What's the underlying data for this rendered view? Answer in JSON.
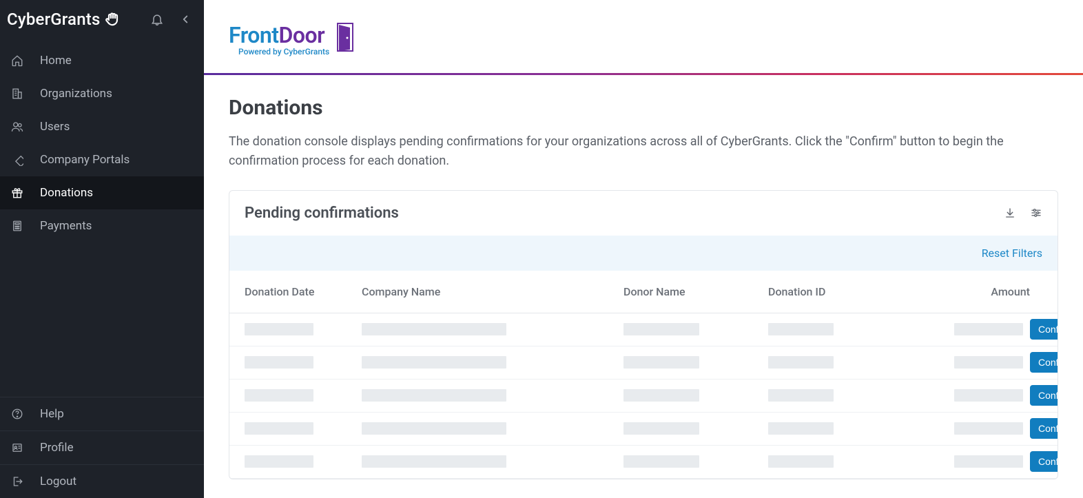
{
  "brand": {
    "name": "CyberGrants"
  },
  "sidebar": {
    "items": [
      {
        "id": "home",
        "label": "Home",
        "icon": "home-icon"
      },
      {
        "id": "orgs",
        "label": "Organizations",
        "icon": "building-icon"
      },
      {
        "id": "users",
        "label": "Users",
        "icon": "users-icon"
      },
      {
        "id": "portals",
        "label": "Company Portals",
        "icon": "diamond-icon"
      },
      {
        "id": "donations",
        "label": "Donations",
        "icon": "gift-icon",
        "active": true
      },
      {
        "id": "payments",
        "label": "Payments",
        "icon": "calc-icon"
      }
    ],
    "bottom": [
      {
        "id": "help",
        "label": "Help",
        "icon": "help-icon"
      },
      {
        "id": "profile",
        "label": "Profile",
        "icon": "id-icon"
      },
      {
        "id": "logout",
        "label": "Logout",
        "icon": "logout-icon"
      }
    ]
  },
  "logo": {
    "front": "Front",
    "door": "Door",
    "subtitle": "Powered by CyberGrants"
  },
  "page": {
    "title": "Donations",
    "description": "The donation console displays pending confirmations for your organizations across all of CyberGrants. Click the \"Confirm\" button to begin the confirmation process for each donation."
  },
  "panel": {
    "title": "Pending confirmations",
    "reset_label": "Reset Filters",
    "columns": {
      "donation_date": "Donation Date",
      "company_name": "Company Name",
      "donor_name": "Donor Name",
      "donation_id": "Donation ID",
      "amount": "Amount"
    },
    "confirm_label": "Confirm",
    "row_count": 5
  }
}
